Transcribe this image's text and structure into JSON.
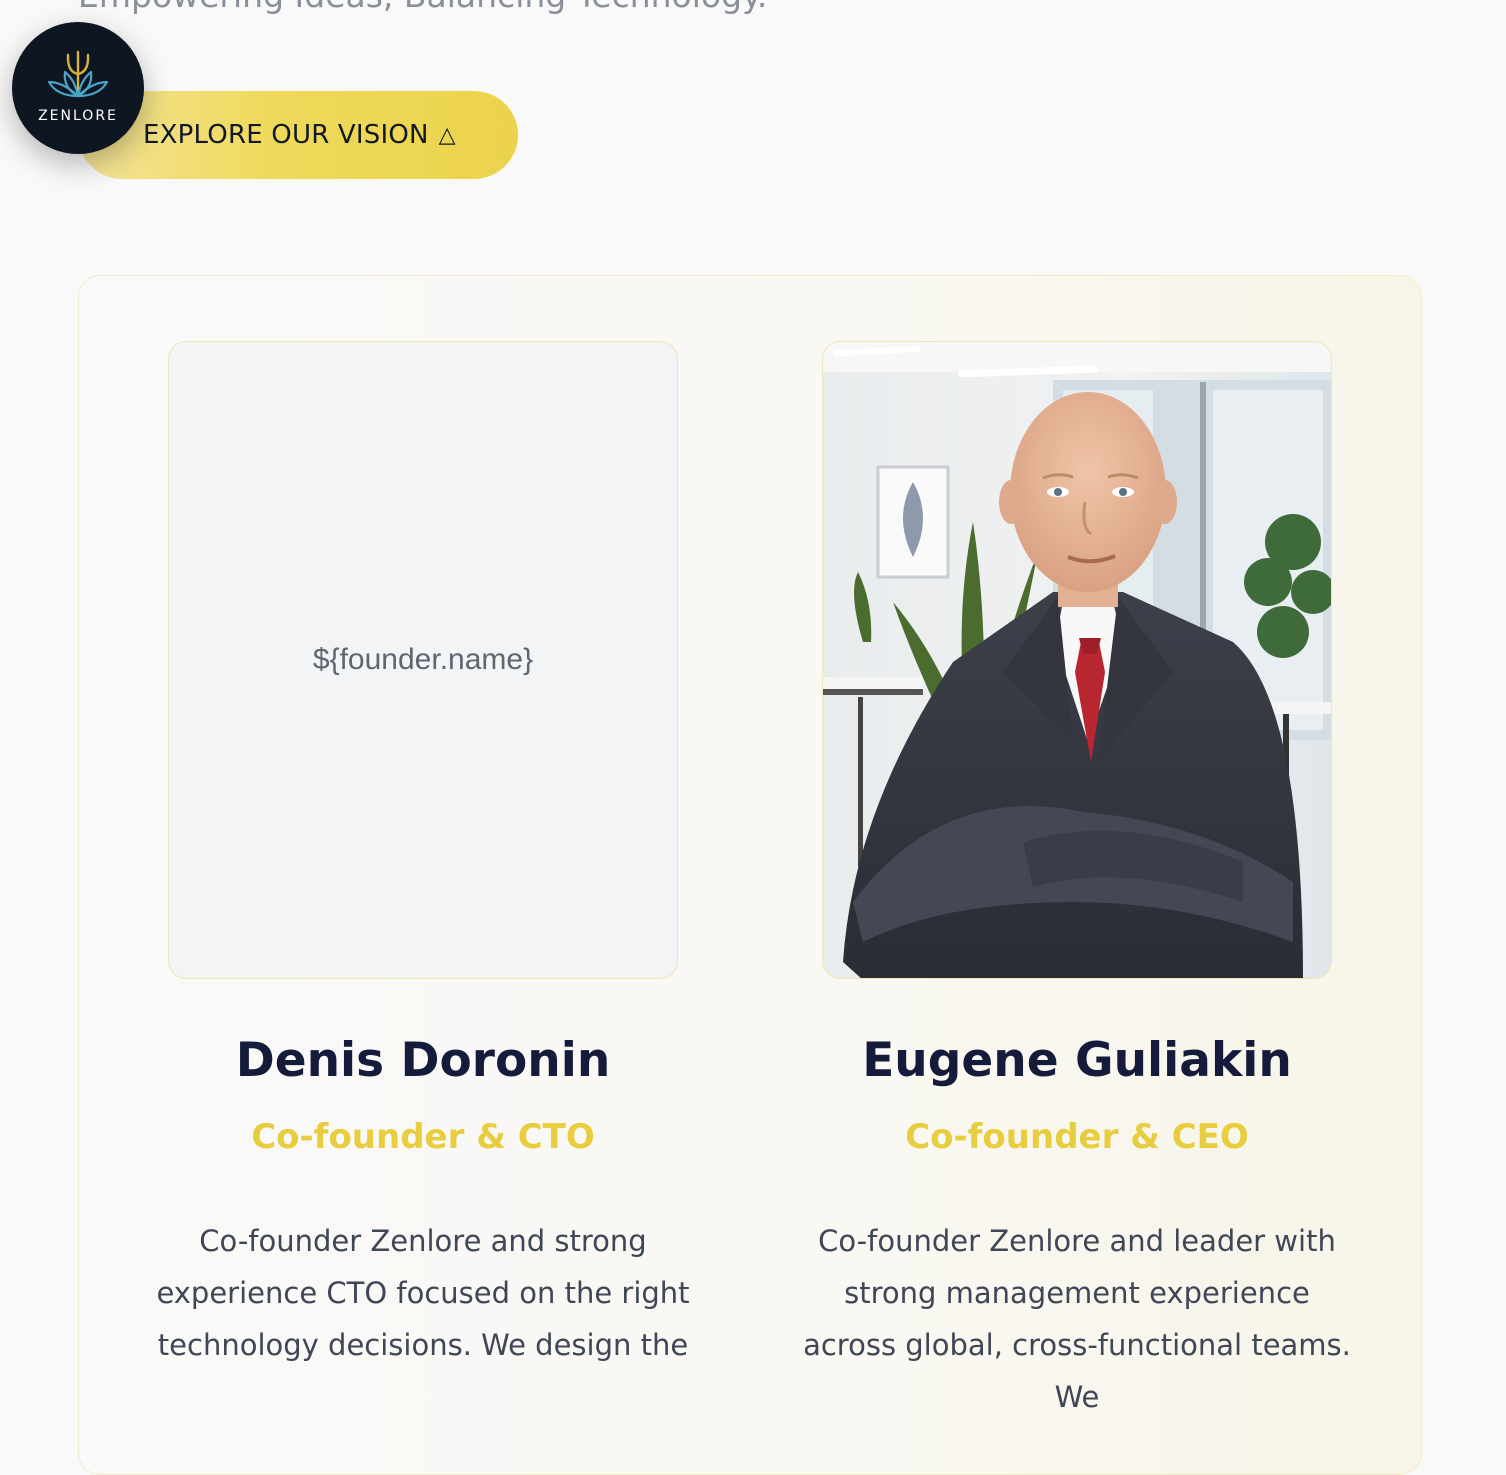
{
  "hero": {
    "tagline": "Empowering Ideas, Balancing Technology.",
    "cta_label": "EXPLORE OUR VISION",
    "cta_icon": "△"
  },
  "logo": {
    "brand": "ZENLORE",
    "icon": "lotus-trident-icon"
  },
  "founders": [
    {
      "name": "Denis Doronin",
      "role": "Co-founder & CTO",
      "photo_placeholder": "${founder.name}",
      "bio": "Co-founder Zenlore and strong experience CTO focused on the right technology decisions. We design the"
    },
    {
      "name": "Eugene Guliakin",
      "role": "Co-founder & CEO",
      "bio": "Co-founder Zenlore and leader with strong management experience across global, cross-functional teams. We"
    }
  ],
  "colors": {
    "accent": "#E8CD3F",
    "cta_bg": "#EDD653",
    "heading": "#151B3A",
    "logo_bg": "#0E1621"
  }
}
